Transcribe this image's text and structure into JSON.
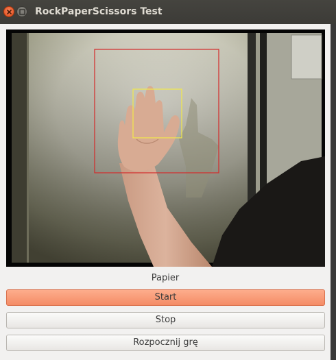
{
  "window": {
    "title": "RockPaperScissors Test"
  },
  "camera": {
    "detected_gesture": "Papier"
  },
  "controls": {
    "start_label": "Start",
    "stop_label": "Stop",
    "start_game_label": "Rozpocznij grę"
  },
  "colors": {
    "titlebar": "#3c3b37",
    "close_button": "#e9572c",
    "start_button": "#f79a77",
    "detection_outer": "#d42a2a",
    "detection_inner": "#f2e94a"
  }
}
